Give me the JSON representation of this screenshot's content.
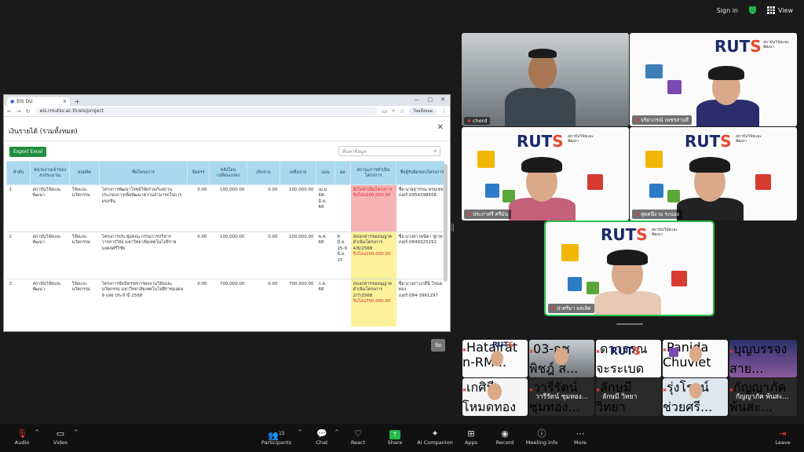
{
  "top_bar": {
    "sign_in": "Sign in",
    "view": "View"
  },
  "browser": {
    "tab_title": "EIS DU",
    "url": "eis.rmutsv.ac.th/eis/project",
    "profile": "ใหม่ทั้งหมด"
  },
  "modal": {
    "title": "เงินรายได้ (รวมทั้งหมด)",
    "export_label": "Export Excel",
    "search_placeholder": "ค้นหาข้อมูล",
    "close_label": "ปิด",
    "headers": [
      "ลำดับ",
      "หน่วยงานเจ้าของงบประมาณ",
      "ผลผลิต",
      "ชื่อโครงการ",
      "จัดสรร",
      "หลังโอนเปลี่ยนแปลง",
      "เบิกจ่าย",
      "เหลือจ่าย",
      "แผน",
      "ผล",
      "สถานะการดำเนินโครงการ",
      "ชื่อผู้รับผิดชอบโครงการ"
    ],
    "rows": [
      {
        "no": "1",
        "unit": "สถาบันวิจัยและพัฒนา",
        "output": "วิจัยและนวัตกรรม",
        "project": "โครงการพัฒนาโจทย์วิจัยร่วมกับสถานประกอบการเพื่อพัฒนาความสามารถในการแข่งขัน",
        "allocated": "0.00",
        "after_transfer": "100,000.00",
        "disbursed": "0.00",
        "remaining": "100,000.00",
        "plan": "เม.ย. 68-มิ.ย. 68",
        "result": "",
        "status": "ยังไม่ดำเนินโครงการ",
        "status_amount": "รับโอน100,000.00",
        "status_color": "#f6b3b3",
        "owner": "ชื่อ:นายสุวรรณ พรมเชย",
        "phone": "เบอร์:0954398656"
      },
      {
        "no": "2",
        "unit": "สถาบันวิจัยและพัฒนา",
        "output": "วิจัยและนวัตกรรม",
        "project": "โครงการประชุมคณะกรรมการบริหารวารสารวิจัย มหาวิทยาลัยเทคโนโลยีราชมงคลศรีวิชัย",
        "allocated": "0.00",
        "after_transfer": "100,000.00",
        "disbursed": "0.00",
        "remaining": "100,000.00",
        "plan": "พ.ค. 68",
        "result": "8 มิ.ย. 25-9 มิ.ย. 25",
        "status": "ส่งเอกสารขออนุญาตดำเนินโครงการ 4/6/2568",
        "status_amount": "รับโอน100,000.00",
        "status_color": "#fbf29a",
        "owner": "ชื่อ:นางสาวพนิดา ชูเวท",
        "phone": "เบอร์:0849325292"
      },
      {
        "no": "3",
        "unit": "สถาบันวิจัยและพัฒนา",
        "output": "วิจัยและนวัตกรรม",
        "project": "โครงการจัดนิทรรศการผลงานวิจัยและนวัตกรรม มหาวิทยาลัยเทคโนโลยีราชมงคล 9 แห่ง ประจำปี 2568",
        "allocated": "0.00",
        "after_transfer": "700,000.00",
        "disbursed": "0.00",
        "remaining": "700,000.00",
        "plan": "ก.ค. 68",
        "result": "",
        "status": "ส่งเอกสารขออนุญาตดำเนินโครงการ 2/7/2568",
        "status_amount": "รับโอน700,000.00",
        "status_color": "#fbf29a",
        "owner": "ชื่อ:นางสาวเกสินี โหมดทอง",
        "phone": "เบอร์:084-3961297"
      }
    ]
  },
  "tiles": {
    "t1": "cherd",
    "t2": "จริยาภรณ์ เพชรสามสี",
    "t3": "ประภาศรี ศรีมัน",
    "t4": "สุดคนึง ณ ระนอง",
    "t5": "ปาศริมา ผลเลิศ",
    "logo_main": "RUTS",
    "logo_sub": "สถาบันวิจัยและพัฒนา"
  },
  "strip": {
    "s1": "Hatairat n-RM...",
    "s2": "03-กชพิชฎ์ ส...",
    "s3": "ดาวรรณ จะระเบด",
    "s4": "Panida Chuviet",
    "s5": "บุญบรรจง สาย...",
    "s6": "เกศินี โหมดทอง",
    "s7_big": "วารีรัตน์ ชุมทอง...",
    "s7": "วารีรัตน์ ชุมทอง...",
    "s8_big": "ลักษมี วิทยา",
    "s8": "ลักษมี วิทยา",
    "s9": "รุ่งโรจน์ ช่วยศรี...",
    "s10_big": "กัญญาภัค พ้นสะ...",
    "s10": "กัญญาภัค พ้นสะ..."
  },
  "toolbar": {
    "audio": "Audio",
    "video": "Video",
    "participants": "Participants",
    "participants_count": "15",
    "chat": "Chat",
    "react": "React",
    "share": "Share",
    "ai": "AI Companion",
    "apps": "Apps",
    "record": "Record",
    "meeting_info": "Meeting info",
    "more": "More",
    "leave": "Leave"
  }
}
